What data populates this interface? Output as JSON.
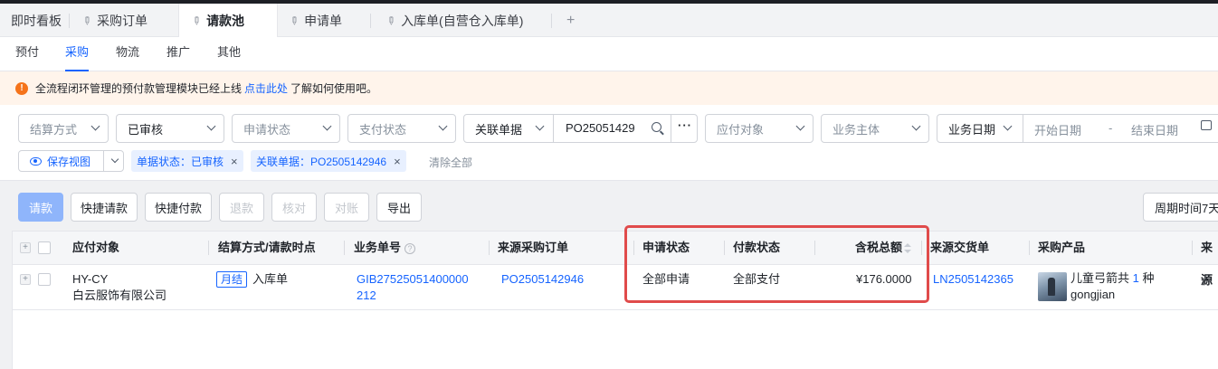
{
  "tabs": [
    {
      "label": "即时看板",
      "pinned": false,
      "active": false
    },
    {
      "label": "采购订单",
      "pinned": true,
      "active": false
    },
    {
      "label": "请款池",
      "pinned": true,
      "active": true
    },
    {
      "label": "申请单",
      "pinned": true,
      "active": false
    },
    {
      "label": "入库单(自营仓入库单)",
      "pinned": true,
      "active": false
    }
  ],
  "tab_add_label": "+",
  "subtabs": [
    "预付",
    "采购",
    "物流",
    "推广",
    "其他"
  ],
  "active_subtab": "采购",
  "notice": {
    "text_before": "全流程闭环管理的预付款管理模块已经上线",
    "link": "点击此处",
    "text_after": "了解如何使用吧。",
    "icon": "!"
  },
  "filters": {
    "settlement": "结算方式",
    "audit": "已审核",
    "apply_status": "申请状态",
    "pay_status": "支付状态",
    "related_doc": "关联单据",
    "related_doc_value": "PO25051429",
    "more": "···",
    "payee": "应付对象",
    "entity": "业务主体",
    "date_type": "业务日期",
    "start_date": "开始日期",
    "date_sep": "-",
    "end_date": "结束日期",
    "save_view": "保存视图",
    "chips": [
      {
        "label": "单据状态：已审核",
        "close": "×"
      },
      {
        "label": "关联单据：PO2505142946",
        "close": "×"
      }
    ],
    "clear_all": "清除全部"
  },
  "toolbar": {
    "buttons": [
      "请款",
      "快捷请款",
      "快捷付款",
      "退款",
      "核对",
      "对账",
      "导出"
    ],
    "period": "周期时间7天"
  },
  "table": {
    "columns": [
      "应付对象",
      "结算方式/请款时点",
      "业务单号",
      "来源采购订单",
      "申请状态",
      "付款状态",
      "含税总额",
      "来源交货单",
      "采购产品",
      "来源"
    ],
    "help_glyph": "?",
    "rows": [
      {
        "payee_code": "HY-CY",
        "payee_name": "白云服饰有限公司",
        "settle_tag": "月结",
        "settle_point": "入库单",
        "biz_no_line1": "GIB27525051400000",
        "biz_no_line2": "212",
        "po": "PO2505142946",
        "apply_status": "全部申请",
        "pay_status": "全部支付",
        "total": "¥176.0000",
        "delivery": "LN2505142365",
        "product_prefix": "儿童弓箭共",
        "product_count": "1",
        "product_suffix": "种",
        "product_sku": "gongjian",
        "source": "--"
      }
    ]
  },
  "colors": {
    "accent": "#1664ff",
    "highlight": "#e04b4b",
    "warning": "#f5731a"
  }
}
